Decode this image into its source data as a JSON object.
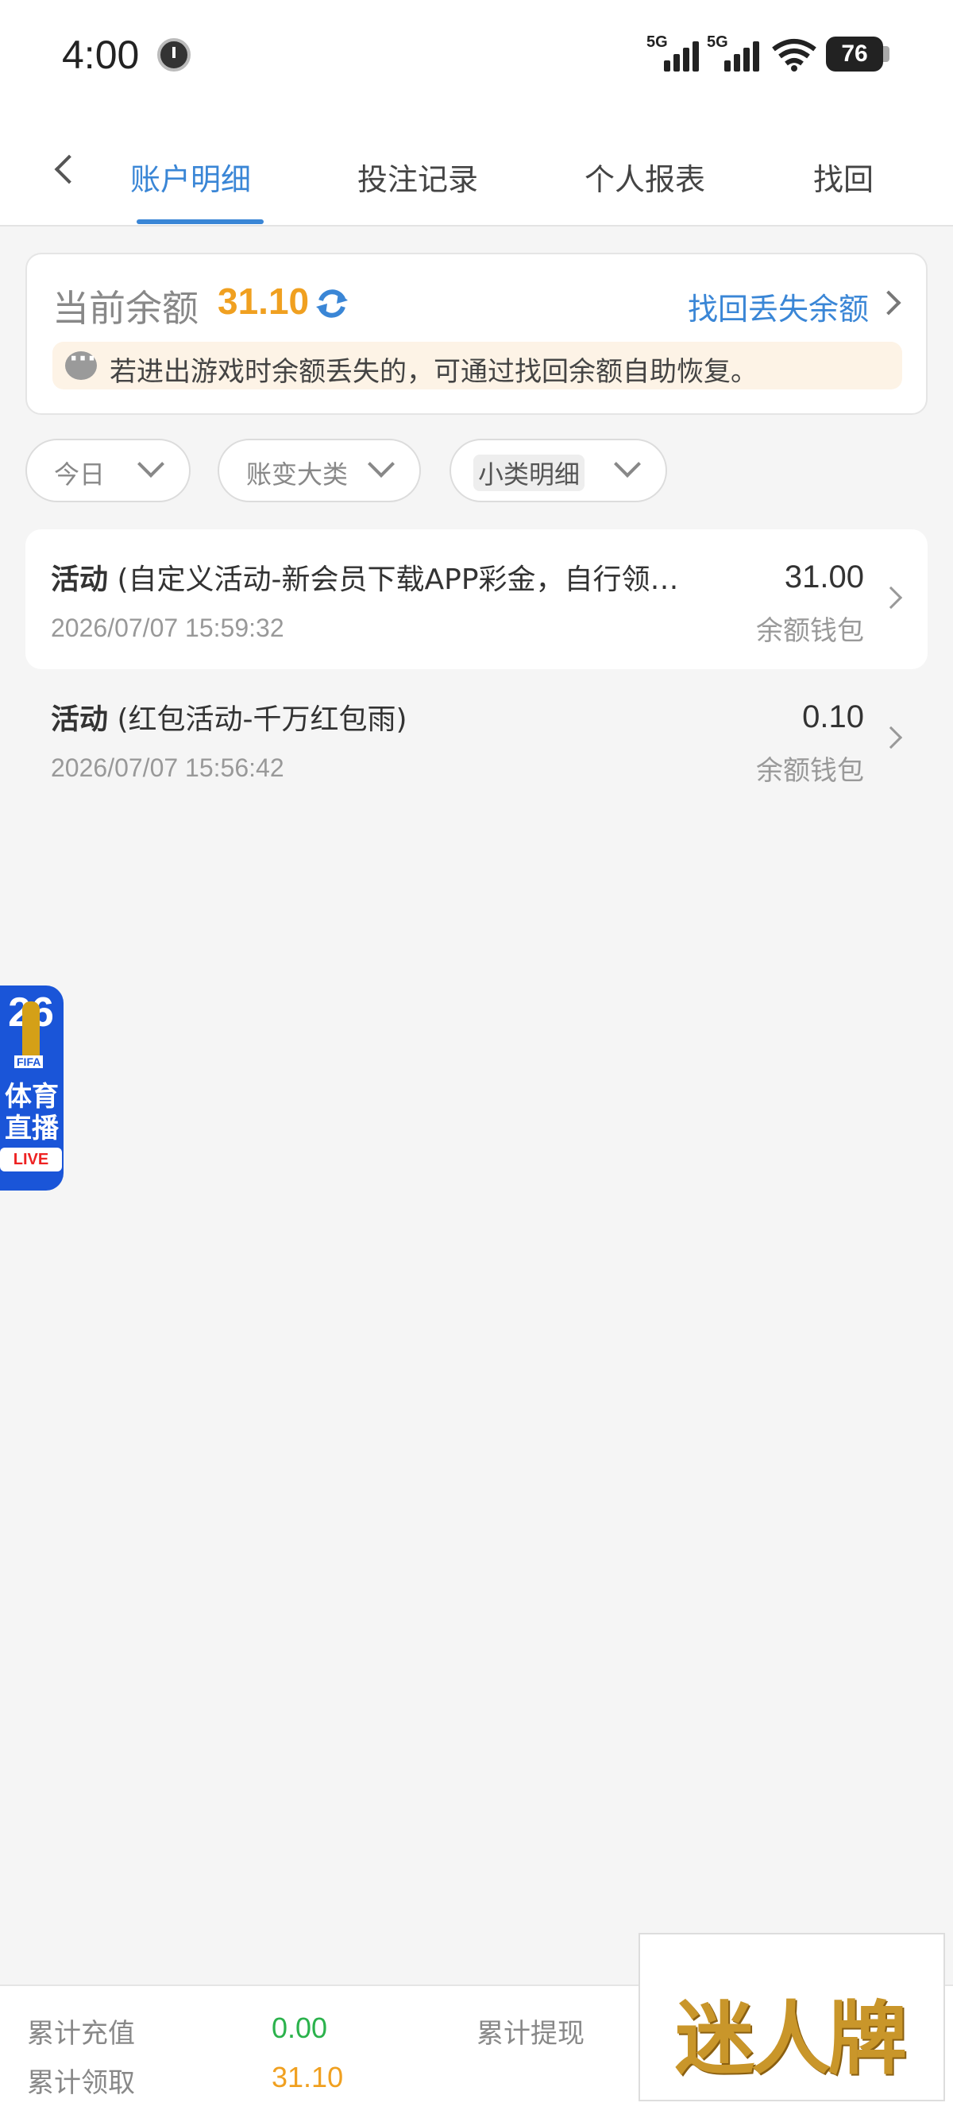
{
  "status_bar": {
    "time": "4:00",
    "signal1_label": "5G",
    "signal2_label": "5G",
    "battery": "76"
  },
  "tabs": {
    "back_icon": "chevron-left-icon",
    "items": [
      {
        "label": "账户明细",
        "active": true
      },
      {
        "label": "投注记录",
        "active": false
      },
      {
        "label": "个人报表",
        "active": false
      },
      {
        "label": "找回",
        "active": false
      }
    ]
  },
  "balance": {
    "label": "当前余额",
    "value": "31.10",
    "recover_link": "找回丢失余额",
    "notice": "若进出游戏时余额丢失的，可通过找回余额自助恢复。"
  },
  "filters": [
    {
      "label": "今日"
    },
    {
      "label": "账变大类"
    },
    {
      "label": "小类明细"
    }
  ],
  "records": [
    {
      "category": "活动",
      "detail": " (自定义活动-新会员下载APP彩金，自行领…",
      "time": "2026/07/07 15:59:32",
      "amount": "31.00",
      "wallet": "余额钱包"
    },
    {
      "category": "活动",
      "detail": " (红包活动-千万红包雨)",
      "time": "2026/07/07 15:56:42",
      "amount": "0.10",
      "wallet": "余额钱包"
    }
  ],
  "sports_banner": {
    "number": "26",
    "fifa": "FIFA",
    "text_line1": "体育",
    "text_line2": "直播",
    "live": "LIVE"
  },
  "footer": {
    "total_recharge_label": "累计充值",
    "total_recharge_value": "0.00",
    "total_withdraw_label": "累计提现",
    "total_claim_label": "累计领取",
    "total_claim_value": "31.10"
  },
  "watermark": "迷人牌",
  "colors": {
    "accent": "#3a86d6",
    "balance": "#f0a020",
    "green": "#2bb24c"
  }
}
